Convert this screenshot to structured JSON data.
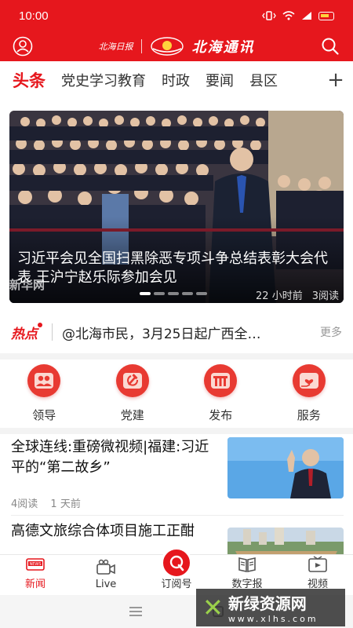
{
  "status_bar": {
    "time": "10:00"
  },
  "header": {
    "brand_small": "北海日报",
    "brand_main": "北海通讯"
  },
  "tabs": [
    {
      "label": "头条"
    },
    {
      "label": "党史学习教育"
    },
    {
      "label": "时政"
    },
    {
      "label": "要闻"
    },
    {
      "label": "县区"
    }
  ],
  "tabs_add": "+",
  "banner": {
    "title": "习近平会见全国扫黑除恶专项斗争总结表彰大会代表 王沪宁赵乐际参加会见",
    "time": "22 小时前",
    "reads": "3阅读",
    "watermark": "新华网"
  },
  "hot": {
    "label": "热点",
    "text": "@北海市民，3月25日起广西全…",
    "more": "更多"
  },
  "quick_links": [
    {
      "label": "领导",
      "icon": "people-icon"
    },
    {
      "label": "党建",
      "icon": "hammer-sickle-icon"
    },
    {
      "label": "发布",
      "icon": "podium-icon"
    },
    {
      "label": "服务",
      "icon": "hand-heart-icon"
    }
  ],
  "news": [
    {
      "title": "全球连线:重磅微视频|福建:习近平的“第二故乡”",
      "reads": "4阅读",
      "time": "1 天前"
    },
    {
      "title": "高德文旅综合体项目施工正酣"
    }
  ],
  "tabbar": [
    {
      "label": "新闻",
      "icon": "news-icon",
      "badge": "NEWS"
    },
    {
      "label": "Live",
      "icon": "video-camera-icon"
    },
    {
      "label": "订阅号",
      "icon": "subscribe-icon"
    },
    {
      "label": "数字报",
      "icon": "book-icon"
    },
    {
      "label": "视频",
      "icon": "play-icon"
    }
  ],
  "watermark": {
    "name": "新绿资源网",
    "url": "www.xlhs.com"
  },
  "colors": {
    "brand_red": "#e6171d",
    "quick_red": "#e83a32"
  }
}
